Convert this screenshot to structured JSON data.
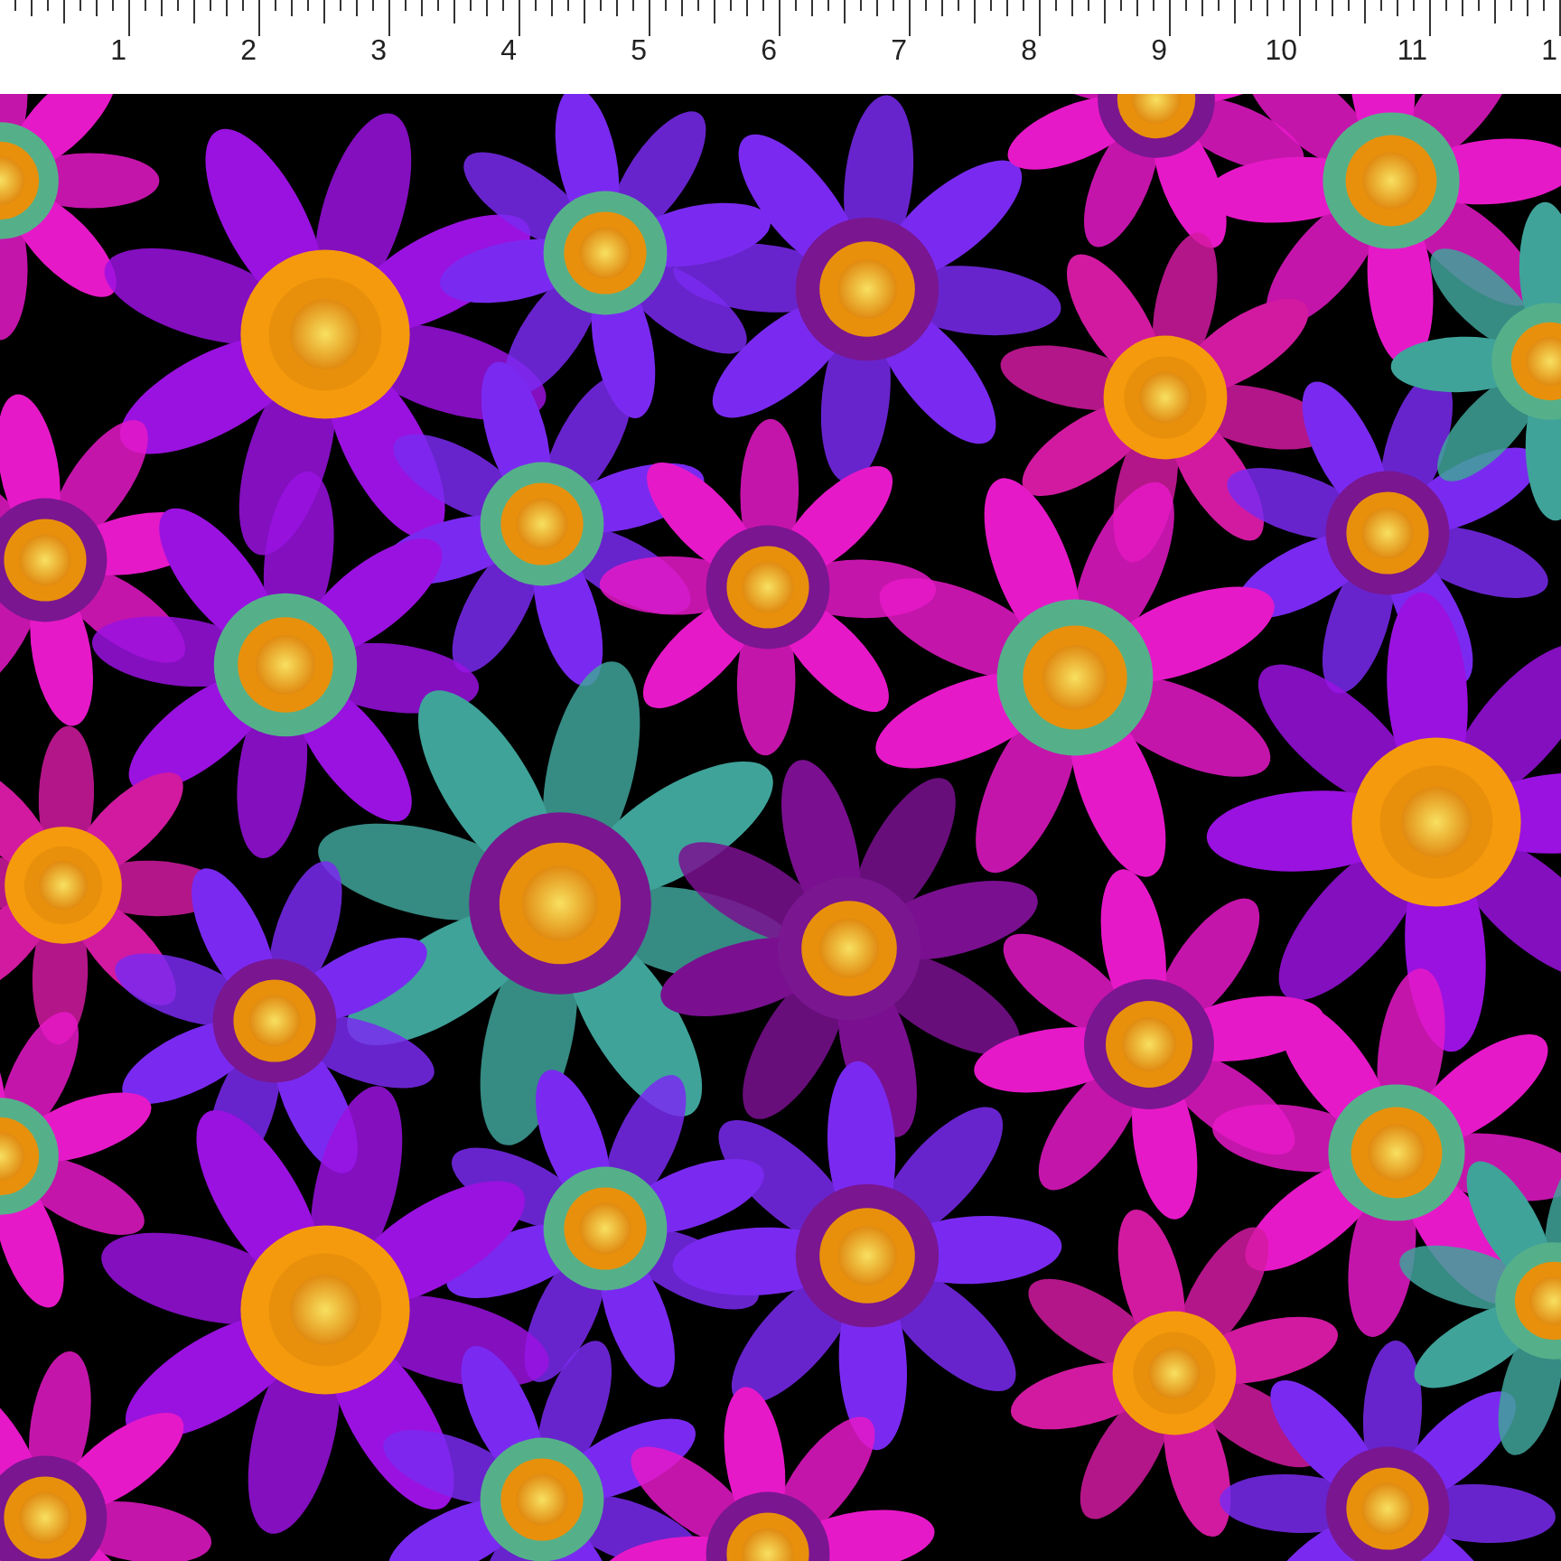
{
  "ruler": {
    "marks": [
      "1",
      "2",
      "3",
      "4",
      "5",
      "6",
      "7",
      "8",
      "9",
      "10",
      "11",
      "1"
    ]
  }
}
